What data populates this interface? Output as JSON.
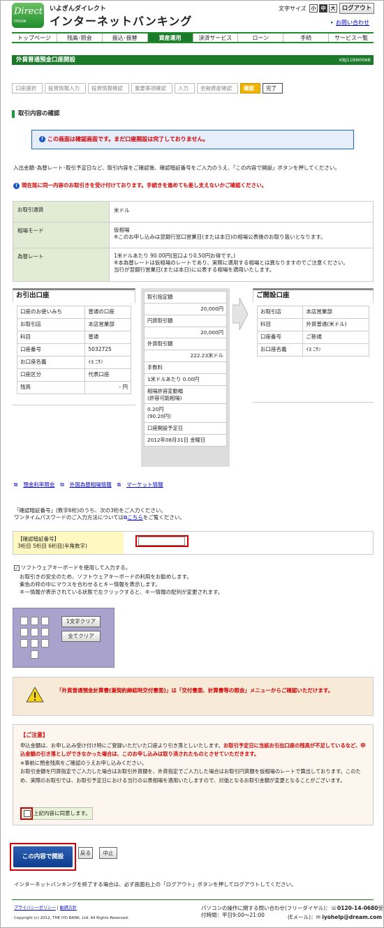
{
  "header": {
    "logo_text": "Direct",
    "logo_sub": "IYOGIN",
    "bank_name": "いよぎんダイレクト",
    "service_name": "インターネットバンキング",
    "font_size_label": "文字サイズ",
    "font_sizes": [
      "小",
      "中",
      "大"
    ],
    "logout": "ログアウト",
    "inquiry": "お問い合わせ"
  },
  "nav": [
    "トップページ",
    "残高･照会",
    "振込･振替",
    "資産運用",
    "決済サービス",
    "ローン",
    "手続",
    "サービス一覧"
  ],
  "page": {
    "title": "外貨普通預金口座開設",
    "code": "KBJ11BN006B"
  },
  "steps": [
    "口座選択",
    "投資情報入力",
    "投資情報確認",
    "重要事項確認",
    "入力",
    "金融資産確認",
    "確認",
    "完了"
  ],
  "section_title": "取引内容の確認",
  "notice": "この画面は確認画面です。まだ口座開設は完了しておりません。",
  "intro": "入出金額･為替レート･取引予定日など、取引内容をご確認後、確認暗証番号をご入力のうえ、「この内容で開設」ボタンを押してください。",
  "warning": "現在既に同一内容のお取引きを受け付けております。手続きを進めても差し支えないかご確認ください。",
  "trade": {
    "currency_label": "お取引通貨",
    "currency": "米ドル",
    "mode_label": "相場モード",
    "mode": "仮相場",
    "mode_note": "※このお申し込みは翌銀行窓口営業日(または本日)の相場公表後のお取り扱いとなります。",
    "rate_label": "為替レート",
    "rate_line1": "1米ドルあたり 90.00円(窓口より0.50円お得です。)",
    "rate_line2": "※本為替レートは仮相場のレートであり、実際に適用する相場とは異なりますのでご注意ください。",
    "rate_line3": "当行が翌銀行営業日(または本日)に公表する相場を適用いたします。"
  },
  "source": {
    "title": "お引出口座",
    "rows": [
      [
        "口座のお使いみち",
        "普通の口座"
      ],
      [
        "お取引店",
        "本店営業部"
      ],
      [
        "科目",
        "普通"
      ],
      [
        "口座番号",
        "5032725"
      ],
      [
        "お口座名義",
        "ｲﾖ ﾆｻﾝ"
      ],
      [
        "口座区分",
        "代表口座"
      ],
      [
        "残高",
        "- 円"
      ]
    ]
  },
  "center": {
    "scheduled_amount_label": "取引指定額",
    "scheduled_amount": "20,000円",
    "yen_amount_label": "円貨取引額",
    "yen_amount": "20,000円",
    "fx_amount_label": "外貨取引額",
    "fx_amount": "222.23米ドル",
    "fee_label": "手数料",
    "fee": "1米ドルあたり 0.00円",
    "allowance_label1": "相場許容変動幅",
    "allowance_label2": "(許容可能相場)",
    "allowance_value1": "0.20円",
    "allowance_value2": "(90.20円)",
    "date_label": "口座開設予定日",
    "date": "2012年08月31日 金曜日"
  },
  "dest": {
    "title": "ご開設口座",
    "rows": [
      [
        "お取引店",
        "本店営業部"
      ],
      [
        "科目",
        "外貨普通(米ドル)"
      ],
      [
        "口座番号",
        "ご新規"
      ],
      [
        "お口座名義",
        "ｲﾖ ﾆｻﾝ"
      ]
    ]
  },
  "links": [
    "預金利率照会",
    "外国為替相場情報",
    "マーケット情報"
  ],
  "auth": {
    "text1": "「確認暗証番号」(数字6桁)のうち、次の3桁をご入力ください。",
    "text2_pre": "ワンタイムパスワードのご入力方法については",
    "text2_link": "こちら",
    "text2_post": "をご覧ください。",
    "label1": "【確認暗証番号】",
    "label2": "3桁目 5桁目 6桁目(半角数字)",
    "value": ""
  },
  "software_kb": {
    "check_label": "ソフトウェアキーボードを使用して入力する。",
    "desc1": "お取引きの安全のため、ソフトウェアキーボードの利用をお勧めします。",
    "desc2": "紫色の枠の中にマウスを合わせるとキー情報を表示します。",
    "desc3": "キー情報が表示されている状態で左クリックすると、キー情報の配列が変更されます。",
    "clear_one": "1文字クリア",
    "clear_all": "全てクリア"
  },
  "doc_warning": "「外貨普通預金計算書(兼契約締結時交付書面)」は「交付書面、計算書等の照会」メニューからご確認いただけます。",
  "caution": {
    "title": "【ご注意】",
    "p1_normal": "申込金額は、お申し込み受け付け時にご登録いただいた口座より引き落としいたします。",
    "p1_red": "お取引予定日に当該お引出口座の残高が不足しているなど、申込金額の引き落としができなかった場合は、このお申し込みは取り消されたものとさせていただきます。",
    "p2": "※事前に預金残高をご確認のうえお申し込みください。",
    "p3": "お取引金額を円貨指定でご入力した場合はお取引外貨額を、外貨指定でご入力した場合はお取引円貨額を仮相場のレートで算出しております。このため、実際のお取引では、お取引予定日における当行の公表相場を適用いたしますので、対価となるお取引金額が変更となることがございます。",
    "agree": "上記内容に同意します。"
  },
  "buttons": {
    "submit": "この内容で開設",
    "back": "戻る",
    "cancel": "中止"
  },
  "logout_note": "インターネットバンキングを終了する場合は、必ず画面右上の「ログアウト」ボタンを押してログアウトしてください。",
  "footer": {
    "privacy": "プライバシーポリシー",
    "solicitation": "勧誘方針",
    "copyright": "Copyright (c) 2012, THE IYO BANK, Ltd. All Rights Reserved.",
    "contact_label": "パソコンの操作に関する問い合わせ(フリーダイヤル)：",
    "phone": "0120-14-0680",
    "hours": "受付時間：平日9:00～21:00",
    "email_label": "(Eメール)：",
    "email": "iyohelp@dream.com"
  }
}
